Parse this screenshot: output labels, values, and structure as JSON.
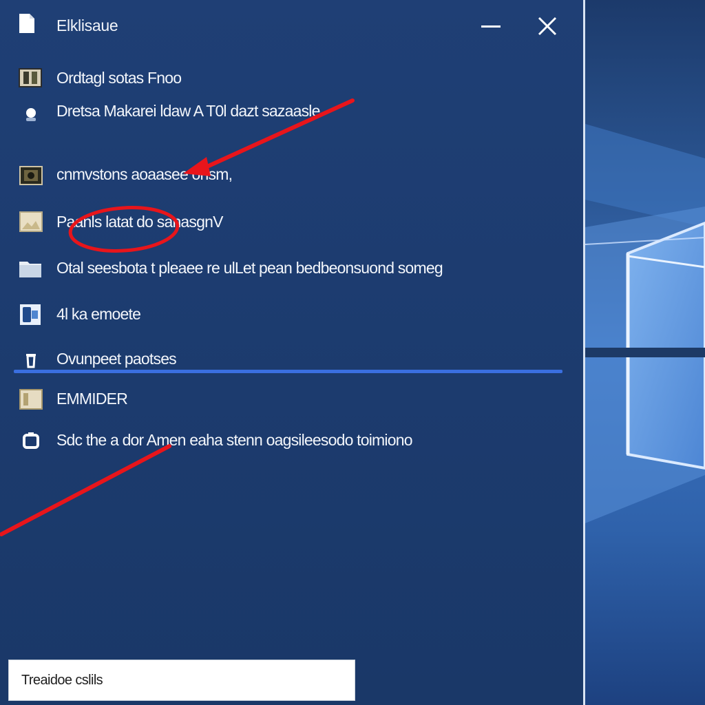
{
  "window": {
    "title": "Elklisaue"
  },
  "menu": {
    "items": [
      {
        "label": "Ordtagl sotas Fnoo",
        "icon": "photo-film-icon"
      },
      {
        "label": "Dretsa Makarei ldaw A T0l dazt sazaasle",
        "icon": "user-icon"
      },
      {
        "label": "cnmvstons aoaasee onsm,",
        "icon": "camera-icon"
      },
      {
        "label": "Paanls latat do sanasgnV",
        "icon": "image-icon"
      },
      {
        "label": "Otal seesbota t pleaee re ulLet pean bedbeonsuond somеg",
        "icon": "folder-icon"
      },
      {
        "label": "4l ka emoete",
        "icon": "phone-icon"
      },
      {
        "label": "Ovunpeet paotses",
        "icon": "trash-icon"
      },
      {
        "label": "EMMIDER",
        "icon": "picture-icon"
      },
      {
        "label": "Sdc the a dor Amen eaha stenn oagsileesodo toimiono",
        "icon": "lock-icon"
      }
    ]
  },
  "status": {
    "text": "Treaidoe cslils"
  },
  "colors": {
    "panel": "#1f3f75",
    "accent": "#3a6fe0",
    "annotation": "#e8151b"
  }
}
